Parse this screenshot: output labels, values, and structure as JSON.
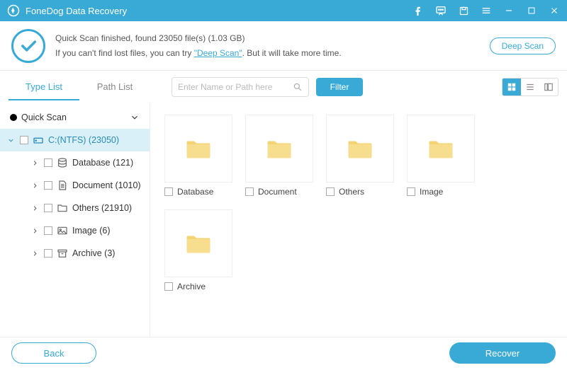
{
  "titlebar": {
    "title": "FoneDog Data Recovery"
  },
  "info": {
    "line1_prefix": "Quick Scan finished, found ",
    "file_count": "23050",
    "line1_mid": " file(s) (",
    "size": "1.03 GB",
    "line1_suffix": ")",
    "line2_prefix": "If you can't find lost files, you can try ",
    "deep_scan_link": "\"Deep Scan\"",
    "line2_suffix": ". But it will take more time.",
    "deep_scan_button": "Deep Scan"
  },
  "toolbar": {
    "tab_type": "Type List",
    "tab_path": "Path List",
    "search_placeholder": "Enter Name or Path here",
    "filter": "Filter"
  },
  "tree": {
    "root": "Quick Scan",
    "drive": "C:(NTFS) (23050)",
    "items": [
      {
        "label": "Database (121)"
      },
      {
        "label": "Document (1010)"
      },
      {
        "label": "Others (21910)"
      },
      {
        "label": "Image (6)"
      },
      {
        "label": "Archive (3)"
      }
    ]
  },
  "folders": [
    {
      "label": "Database"
    },
    {
      "label": "Document"
    },
    {
      "label": "Others"
    },
    {
      "label": "Image"
    },
    {
      "label": "Archive"
    }
  ],
  "footer": {
    "back": "Back",
    "recover": "Recover"
  }
}
